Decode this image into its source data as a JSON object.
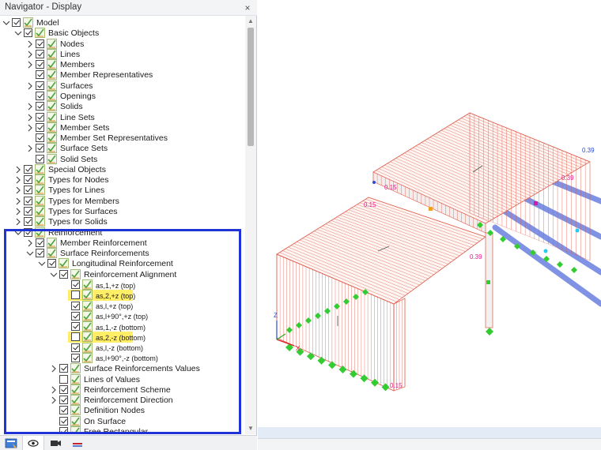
{
  "navigator": {
    "title": "Navigator - Display",
    "close_glyph": "×",
    "tree": [
      {
        "label": "Model",
        "level": 0,
        "expander": "collapse",
        "checked": true
      },
      {
        "label": "Basic Objects",
        "level": 1,
        "expander": "collapse",
        "checked": true
      },
      {
        "label": "Nodes",
        "level": 2,
        "expander": "expand",
        "checked": true
      },
      {
        "label": "Lines",
        "level": 2,
        "expander": "expand",
        "checked": true
      },
      {
        "label": "Members",
        "level": 2,
        "expander": "expand",
        "checked": true
      },
      {
        "label": "Member Representatives",
        "level": 2,
        "expander": "none",
        "checked": true
      },
      {
        "label": "Surfaces",
        "level": 2,
        "expander": "expand",
        "checked": true
      },
      {
        "label": "Openings",
        "level": 2,
        "expander": "none",
        "checked": true
      },
      {
        "label": "Solids",
        "level": 2,
        "expander": "expand",
        "checked": true
      },
      {
        "label": "Line Sets",
        "level": 2,
        "expander": "expand",
        "checked": true
      },
      {
        "label": "Member Sets",
        "level": 2,
        "expander": "expand",
        "checked": true
      },
      {
        "label": "Member Set Representatives",
        "level": 2,
        "expander": "none",
        "checked": true
      },
      {
        "label": "Surface Sets",
        "level": 2,
        "expander": "expand",
        "checked": true
      },
      {
        "label": "Solid Sets",
        "level": 2,
        "expander": "none",
        "checked": true
      },
      {
        "label": "Special Objects",
        "level": 1,
        "expander": "expand",
        "checked": true
      },
      {
        "label": "Types for Nodes",
        "level": 1,
        "expander": "expand",
        "checked": true
      },
      {
        "label": "Types for Lines",
        "level": 1,
        "expander": "expand",
        "checked": true
      },
      {
        "label": "Types for Members",
        "level": 1,
        "expander": "expand",
        "checked": true
      },
      {
        "label": "Types for Surfaces",
        "level": 1,
        "expander": "expand",
        "checked": true
      },
      {
        "label": "Types for Solids",
        "level": 1,
        "expander": "expand",
        "checked": true
      },
      {
        "label": "Reinforcement",
        "level": 1,
        "expander": "collapse",
        "checked": true
      },
      {
        "label": "Member Reinforcement",
        "level": 2,
        "expander": "expand",
        "checked": true
      },
      {
        "label": "Surface Reinforcements",
        "level": 2,
        "expander": "collapse",
        "checked": true
      },
      {
        "label": "Longitudinal Reinforcement",
        "level": 3,
        "expander": "collapse",
        "checked": true
      },
      {
        "label": "Reinforcement Alignment",
        "level": 4,
        "expander": "collapse",
        "checked": true
      },
      {
        "label": "as,1,+z (top)",
        "level": 5,
        "expander": "none",
        "checked": true,
        "small": true
      },
      {
        "label": "as,2,+z (top)",
        "level": 5,
        "expander": "none",
        "checked": false,
        "small": true,
        "highlight": true
      },
      {
        "label": "as,l,+z (top)",
        "level": 5,
        "expander": "none",
        "checked": true,
        "small": true
      },
      {
        "label": "as,l+90°,+z (top)",
        "level": 5,
        "expander": "none",
        "checked": true,
        "small": true
      },
      {
        "label": "as,1,-z (bottom)",
        "level": 5,
        "expander": "none",
        "checked": true,
        "small": true
      },
      {
        "label": "as,2,-z (bottom)",
        "level": 5,
        "expander": "none",
        "checked": false,
        "small": true,
        "highlight": true
      },
      {
        "label": "as,l,-z (bottom)",
        "level": 5,
        "expander": "none",
        "checked": true,
        "small": true
      },
      {
        "label": "as,l+90°,-z (bottom)",
        "level": 5,
        "expander": "none",
        "checked": true,
        "small": true
      },
      {
        "label": "Surface Reinforcements Values",
        "level": 4,
        "expander": "expand",
        "checked": true
      },
      {
        "label": "Lines of Values",
        "level": 4,
        "expander": "none",
        "checked": false
      },
      {
        "label": "Reinforcement Scheme",
        "level": 4,
        "expander": "expand",
        "checked": true
      },
      {
        "label": "Reinforcement Direction",
        "level": 4,
        "expander": "expand",
        "checked": true
      },
      {
        "label": "Definition Nodes",
        "level": 4,
        "expander": "none",
        "checked": true
      },
      {
        "label": "On Surface",
        "level": 4,
        "expander": "none",
        "checked": true
      },
      {
        "label": "Free Rectangular",
        "level": 4,
        "expander": "none",
        "checked": true
      }
    ],
    "footer_tabs": [
      {
        "name": "data-tab",
        "icon": "navigator-data-icon"
      },
      {
        "name": "display-tab",
        "icon": "eye-icon",
        "active": true
      },
      {
        "name": "views-tab",
        "icon": "camera-icon"
      },
      {
        "name": "results-tab",
        "icon": "results-icon"
      }
    ]
  },
  "viewport": {
    "labels": [
      "0.39",
      "0.15",
      "0.39",
      "0.15",
      "0.39",
      "0.15"
    ],
    "axes": {
      "x": "X",
      "z": "Z"
    },
    "colors": {
      "reinforcement": "#e05a4a",
      "support": "#33cc33",
      "member": "#6a7fe0",
      "selection": "#1f33d6",
      "highlight": "#ffee66"
    }
  }
}
